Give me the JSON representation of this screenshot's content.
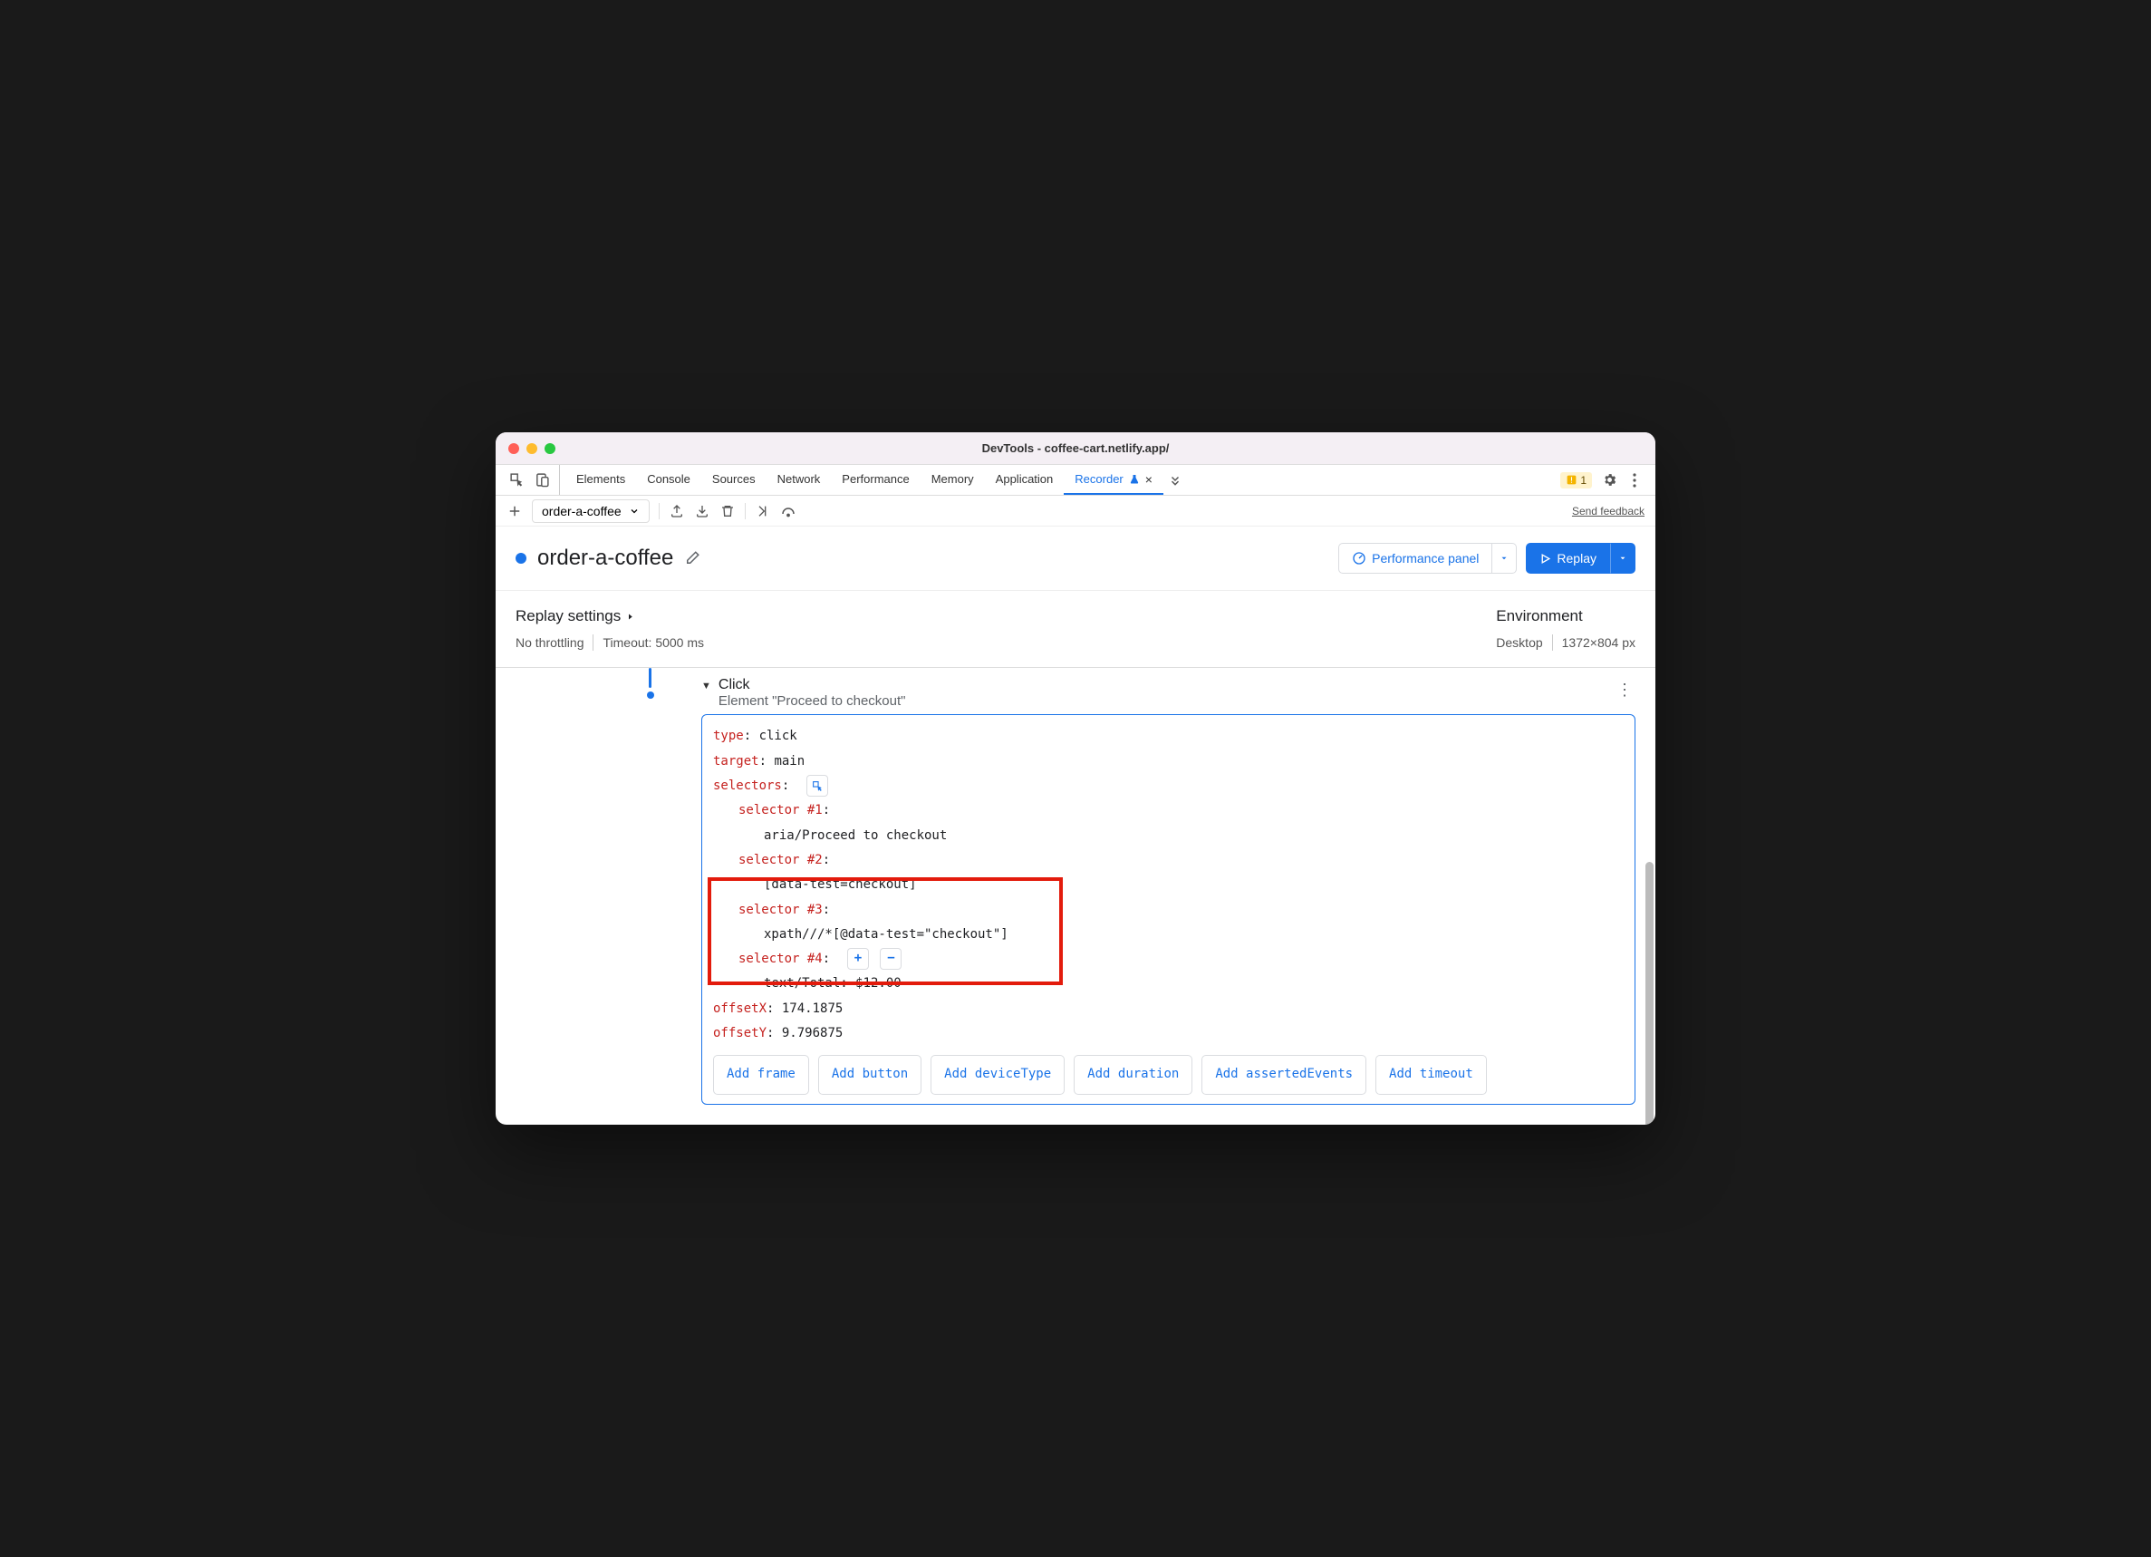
{
  "titlebar": {
    "title": "DevTools - coffee-cart.netlify.app/"
  },
  "tabs": {
    "items": [
      "Elements",
      "Console",
      "Sources",
      "Network",
      "Performance",
      "Memory",
      "Application",
      "Recorder"
    ],
    "active": "Recorder",
    "issuesCount": "1"
  },
  "toolbar": {
    "recordingName": "order-a-coffee",
    "feedback": "Send feedback"
  },
  "header": {
    "title": "order-a-coffee",
    "perfButton": "Performance panel",
    "replayButton": "Replay"
  },
  "settings": {
    "replayHeading": "Replay settings",
    "noThrottling": "No throttling",
    "timeout": "Timeout: 5000 ms",
    "envHeading": "Environment",
    "envDevice": "Desktop",
    "envDims": "1372×804 px"
  },
  "step": {
    "title": "Click",
    "subtitle": "Element \"Proceed to checkout\"",
    "typeKey": "type",
    "typeVal": "click",
    "targetKey": "target",
    "targetVal": "main",
    "selectorsKey": "selectors",
    "sel1Key": "selector #1",
    "sel1Val": "aria/Proceed to checkout",
    "sel2Key": "selector #2",
    "sel2Val": "[data-test=checkout]",
    "sel3Key": "selector #3",
    "sel3Val": "xpath///*[@data-test=\"checkout\"]",
    "sel4Key": "selector #4",
    "sel4Val": "text/Total: $12.00",
    "offsetXKey": "offsetX",
    "offsetXVal": "174.1875",
    "offsetYKey": "offsetY",
    "offsetYVal": "9.796875",
    "addButtons": [
      "Add frame",
      "Add button",
      "Add deviceType",
      "Add duration",
      "Add assertedEvents",
      "Add timeout"
    ]
  }
}
